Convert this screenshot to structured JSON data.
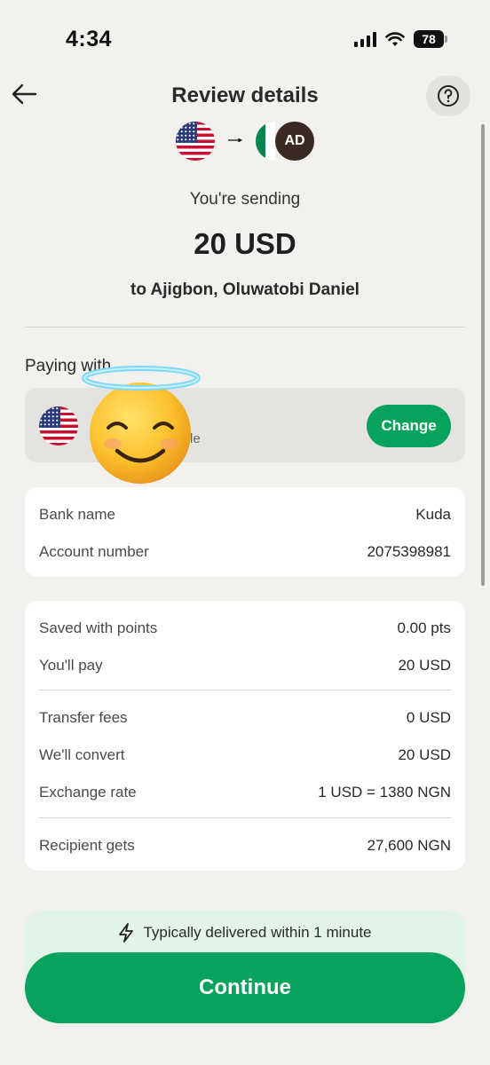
{
  "status_bar": {
    "time": "4:34",
    "battery": "78"
  },
  "header": {
    "title": "Review details"
  },
  "transfer": {
    "recipient_initials": "AD",
    "sending_label": "You're sending",
    "amount": "20 USD",
    "recipient_line": "to Ajigbon, Oluwatobi Daniel"
  },
  "payment": {
    "label": "Paying with",
    "partial_subtext": "le",
    "change_label": "Change"
  },
  "bank": {
    "rows": [
      {
        "key": "Bank name",
        "value": "Kuda"
      },
      {
        "key": "Account number",
        "value": "2075398981"
      }
    ]
  },
  "summary": {
    "rows_a": [
      {
        "key": "Saved with points",
        "value": "0.00 pts"
      },
      {
        "key": "You'll pay",
        "value": "20 USD"
      }
    ],
    "rows_b": [
      {
        "key": "Transfer fees",
        "value": "0 USD"
      },
      {
        "key": "We'll convert",
        "value": "20 USD"
      },
      {
        "key": "Exchange rate",
        "value": "1 USD = 1380 NGN"
      }
    ],
    "rows_c": [
      {
        "key": "Recipient gets",
        "value": "27,600 NGN"
      }
    ]
  },
  "delivery": {
    "text": "Typically delivered within 1 minute"
  },
  "cta": {
    "continue_label": "Continue"
  },
  "colors": {
    "accent": "#07a25b",
    "background": "#f2f1ee"
  },
  "icons": [
    "back-arrow-icon",
    "help-icon",
    "us-flag-icon",
    "arrow-right-icon",
    "ng-flag-icon",
    "lightning-icon",
    "emoji-sticker-icon"
  ]
}
